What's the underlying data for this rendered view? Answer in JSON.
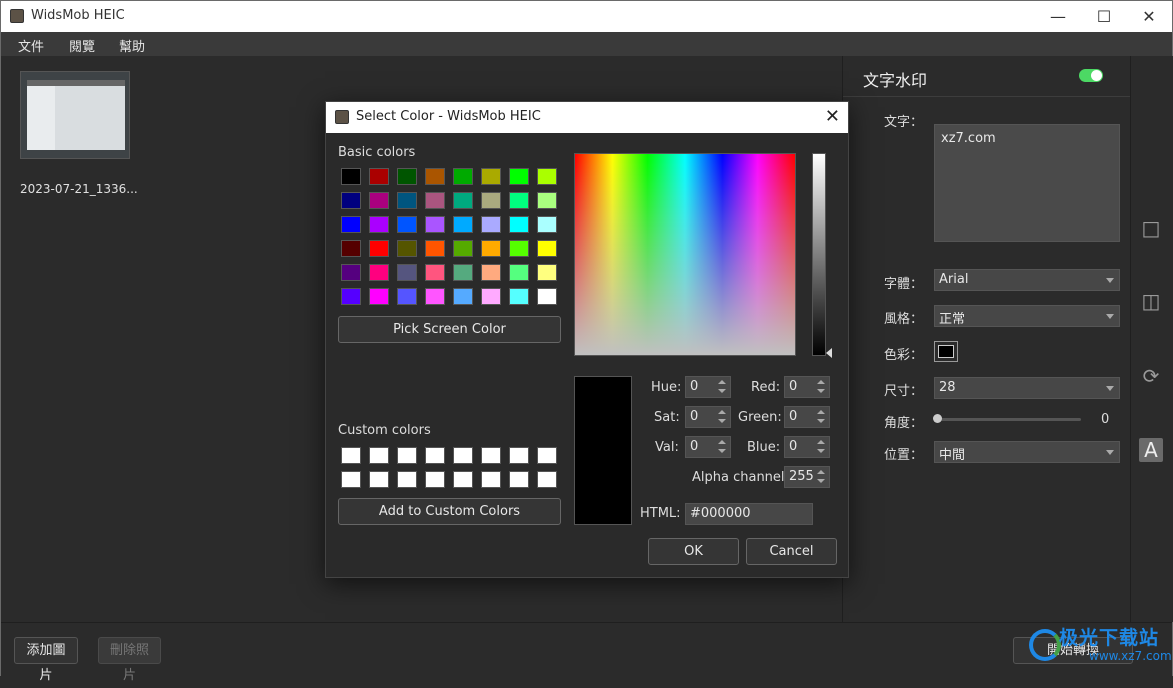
{
  "window": {
    "title": "WidsMob HEIC"
  },
  "menu": [
    {
      "label": "文件"
    },
    {
      "label": "閱覽"
    },
    {
      "label": "幫助"
    }
  ],
  "thumbnail": {
    "label": "2023-07-21_1336..."
  },
  "panel": {
    "title": "文字水印",
    "toggle_on": true,
    "text_label": "文字：",
    "text_value": "xz7.com",
    "font_label": "字體：",
    "font_value": "Arial",
    "style_label": "風格：",
    "style_value": "正常",
    "color_label": "色彩：",
    "color_value": "#000000",
    "size_label": "尺寸：",
    "size_value": "28",
    "angle_label": "角度：",
    "angle_value": "0",
    "position_label": "位置：",
    "position_value": "中間"
  },
  "bottom": {
    "add_label": "添加圖片",
    "remove_label": "刪除照片",
    "start_label": "開始轉換"
  },
  "watermark": {
    "brand": "极光下载站",
    "url": "www.xz7.com"
  },
  "dialog": {
    "title": "Select Color - WidsMob HEIC",
    "basic_colors_label": "Basic colors",
    "pick_screen_label": "Pick Screen Color",
    "custom_colors_label": "Custom colors",
    "add_custom_label": "Add to Custom Colors",
    "hue_label": "Hue:",
    "hue_value": "0",
    "sat_label": "Sat:",
    "sat_value": "0",
    "val_label": "Val:",
    "val_value": "0",
    "red_label": "Red:",
    "red_value": "0",
    "green_label": "Green:",
    "green_value": "0",
    "blue_label": "Blue:",
    "blue_value": "0",
    "alpha_label": "Alpha channel:",
    "alpha_value": "255",
    "html_label": "HTML:",
    "html_value": "#000000",
    "ok_label": "OK",
    "cancel_label": "Cancel",
    "basic_colors": [
      "#000000",
      "#aa0000",
      "#005500",
      "#aa5500",
      "#00aa00",
      "#aaaa00",
      "#00ff00",
      "#aaff00",
      "#00007f",
      "#aa007f",
      "#00557f",
      "#aa557f",
      "#00aa7f",
      "#aaaa7f",
      "#00ff7f",
      "#aaff7f",
      "#0000ff",
      "#aa00ff",
      "#0055ff",
      "#aa55ff",
      "#00aaff",
      "#aaaaff",
      "#00ffff",
      "#aaffff",
      "#550000",
      "#ff0000",
      "#555500",
      "#ff5500",
      "#55aa00",
      "#ffaa00",
      "#55ff00",
      "#ffff00",
      "#55007f",
      "#ff007f",
      "#55557f",
      "#ff557f",
      "#55aa7f",
      "#ffaa7f",
      "#55ff7f",
      "#ffff7f",
      "#5500ff",
      "#ff00ff",
      "#5555ff",
      "#ff55ff",
      "#55aaff",
      "#ffaaff",
      "#55ffff",
      "#ffffff"
    ],
    "custom_colors": [
      "#ffffff",
      "#ffffff",
      "#ffffff",
      "#ffffff",
      "#ffffff",
      "#ffffff",
      "#ffffff",
      "#ffffff",
      "#ffffff",
      "#ffffff",
      "#ffffff",
      "#ffffff",
      "#ffffff",
      "#ffffff",
      "#ffffff",
      "#ffffff"
    ]
  }
}
